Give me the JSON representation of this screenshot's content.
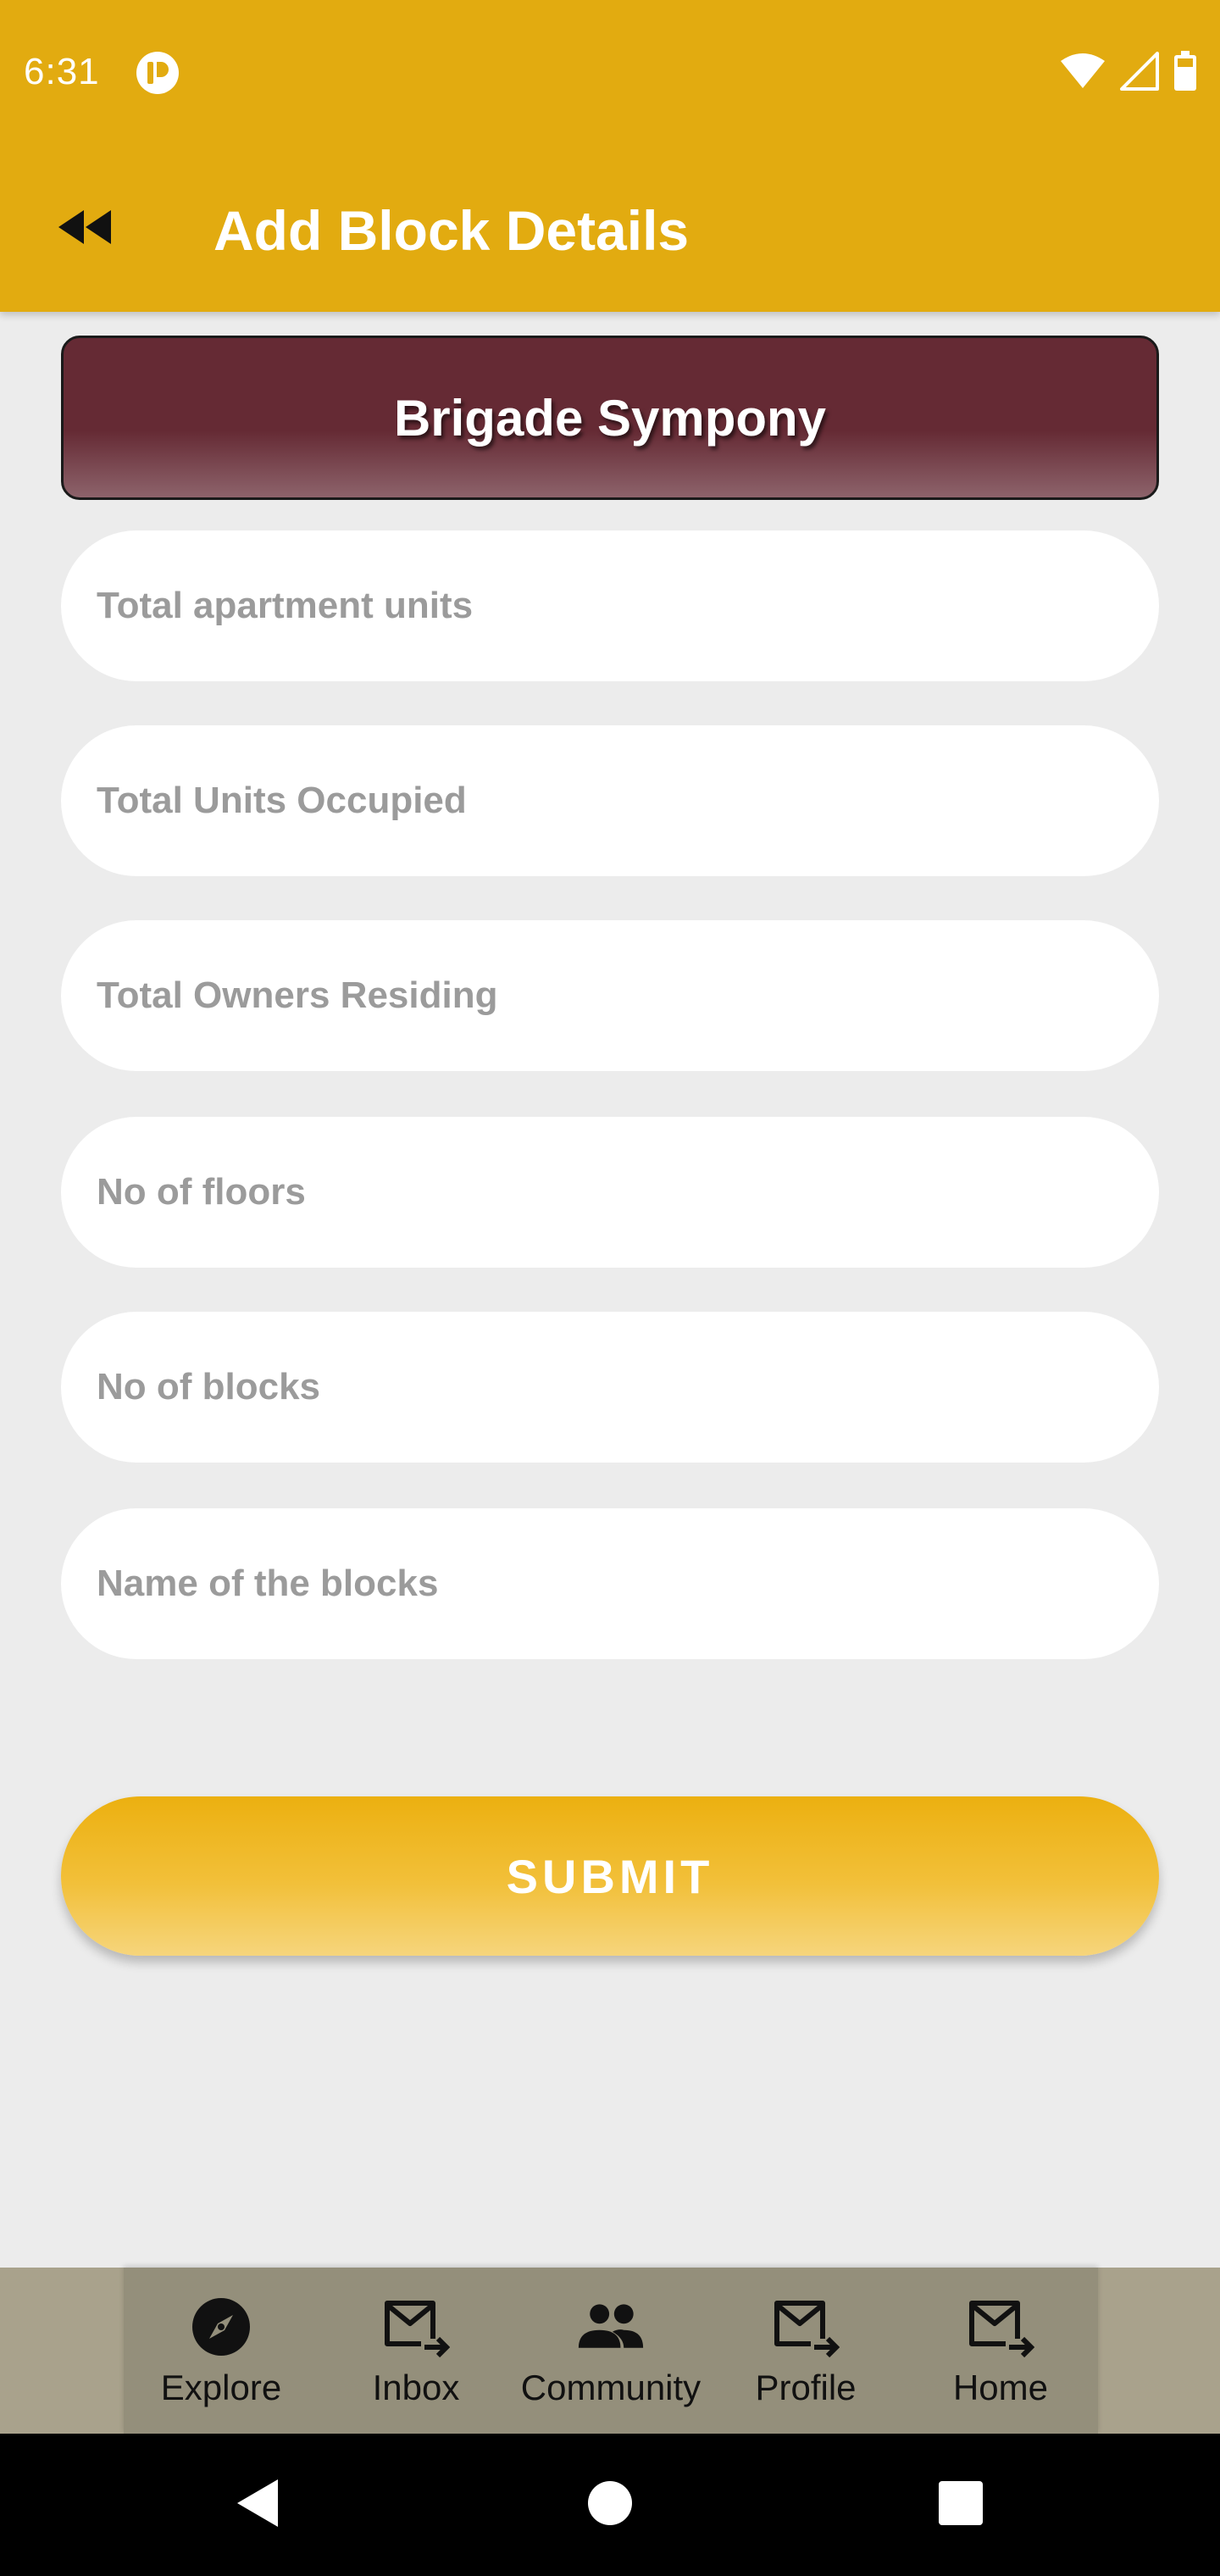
{
  "status_bar": {
    "time": "6:31",
    "icons": [
      "app-notification-icon",
      "wifi-icon",
      "cell-signal-icon",
      "battery-icon"
    ]
  },
  "toolbar": {
    "title": "Add Block Details",
    "back_icon": "double-chevron-left-icon"
  },
  "society": {
    "name": "Brigade Sympony"
  },
  "form": {
    "fields": [
      {
        "placeholder": "Total apartment units",
        "value": ""
      },
      {
        "placeholder": "Total Units Occupied",
        "value": ""
      },
      {
        "placeholder": "Total Owners Residing",
        "value": ""
      },
      {
        "placeholder": "No of floors",
        "value": ""
      },
      {
        "placeholder": "No of blocks",
        "value": ""
      },
      {
        "placeholder": "Name of the blocks",
        "value": ""
      }
    ],
    "submit_label": "SUBMIT"
  },
  "bottom_nav": {
    "items": [
      {
        "label": "Explore",
        "icon": "compass-icon"
      },
      {
        "label": "Inbox",
        "icon": "mail-forward-icon"
      },
      {
        "label": "Community",
        "icon": "people-icon"
      },
      {
        "label": "Profile",
        "icon": "mail-forward-icon"
      },
      {
        "label": "Home",
        "icon": "mail-forward-icon"
      }
    ]
  },
  "system_nav": {
    "buttons": [
      "back-icon",
      "home-icon",
      "recents-icon"
    ]
  },
  "colors": {
    "primary": "#e2ab10",
    "banner": "#652a34",
    "background": "#ececec",
    "bottom_nav": "#948f7b"
  }
}
